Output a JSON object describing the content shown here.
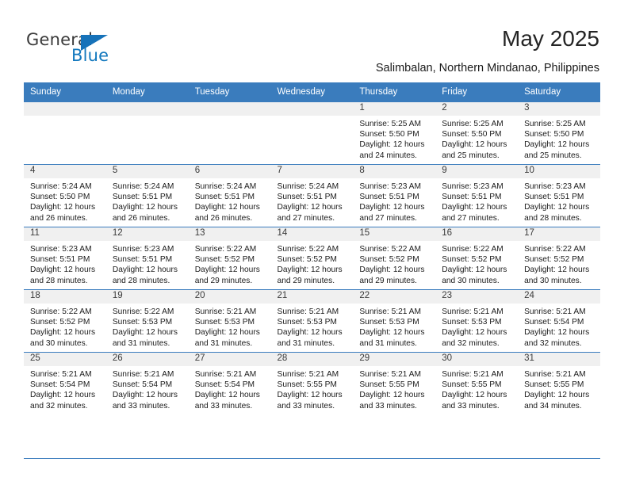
{
  "brand": {
    "name_top": "General",
    "name_bottom": "Blue",
    "triangle_color": "#1672b9",
    "accent_color": "#3a7cbd"
  },
  "header": {
    "title": "May 2025",
    "subtitle": "Salimbalan, Northern Mindanao, Philippines"
  },
  "calendar": {
    "weekday_headers": [
      "Sunday",
      "Monday",
      "Tuesday",
      "Wednesday",
      "Thursday",
      "Friday",
      "Saturday"
    ],
    "weeks": [
      [
        {
          "day": "",
          "lines": []
        },
        {
          "day": "",
          "lines": []
        },
        {
          "day": "",
          "lines": []
        },
        {
          "day": "",
          "lines": []
        },
        {
          "day": "1",
          "lines": [
            "Sunrise: 5:25 AM",
            "Sunset: 5:50 PM",
            "Daylight: 12 hours",
            "and 24 minutes."
          ]
        },
        {
          "day": "2",
          "lines": [
            "Sunrise: 5:25 AM",
            "Sunset: 5:50 PM",
            "Daylight: 12 hours",
            "and 25 minutes."
          ]
        },
        {
          "day": "3",
          "lines": [
            "Sunrise: 5:25 AM",
            "Sunset: 5:50 PM",
            "Daylight: 12 hours",
            "and 25 minutes."
          ]
        }
      ],
      [
        {
          "day": "4",
          "lines": [
            "Sunrise: 5:24 AM",
            "Sunset: 5:50 PM",
            "Daylight: 12 hours",
            "and 26 minutes."
          ]
        },
        {
          "day": "5",
          "lines": [
            "Sunrise: 5:24 AM",
            "Sunset: 5:51 PM",
            "Daylight: 12 hours",
            "and 26 minutes."
          ]
        },
        {
          "day": "6",
          "lines": [
            "Sunrise: 5:24 AM",
            "Sunset: 5:51 PM",
            "Daylight: 12 hours",
            "and 26 minutes."
          ]
        },
        {
          "day": "7",
          "lines": [
            "Sunrise: 5:24 AM",
            "Sunset: 5:51 PM",
            "Daylight: 12 hours",
            "and 27 minutes."
          ]
        },
        {
          "day": "8",
          "lines": [
            "Sunrise: 5:23 AM",
            "Sunset: 5:51 PM",
            "Daylight: 12 hours",
            "and 27 minutes."
          ]
        },
        {
          "day": "9",
          "lines": [
            "Sunrise: 5:23 AM",
            "Sunset: 5:51 PM",
            "Daylight: 12 hours",
            "and 27 minutes."
          ]
        },
        {
          "day": "10",
          "lines": [
            "Sunrise: 5:23 AM",
            "Sunset: 5:51 PM",
            "Daylight: 12 hours",
            "and 28 minutes."
          ]
        }
      ],
      [
        {
          "day": "11",
          "lines": [
            "Sunrise: 5:23 AM",
            "Sunset: 5:51 PM",
            "Daylight: 12 hours",
            "and 28 minutes."
          ]
        },
        {
          "day": "12",
          "lines": [
            "Sunrise: 5:23 AM",
            "Sunset: 5:51 PM",
            "Daylight: 12 hours",
            "and 28 minutes."
          ]
        },
        {
          "day": "13",
          "lines": [
            "Sunrise: 5:22 AM",
            "Sunset: 5:52 PM",
            "Daylight: 12 hours",
            "and 29 minutes."
          ]
        },
        {
          "day": "14",
          "lines": [
            "Sunrise: 5:22 AM",
            "Sunset: 5:52 PM",
            "Daylight: 12 hours",
            "and 29 minutes."
          ]
        },
        {
          "day": "15",
          "lines": [
            "Sunrise: 5:22 AM",
            "Sunset: 5:52 PM",
            "Daylight: 12 hours",
            "and 29 minutes."
          ]
        },
        {
          "day": "16",
          "lines": [
            "Sunrise: 5:22 AM",
            "Sunset: 5:52 PM",
            "Daylight: 12 hours",
            "and 30 minutes."
          ]
        },
        {
          "day": "17",
          "lines": [
            "Sunrise: 5:22 AM",
            "Sunset: 5:52 PM",
            "Daylight: 12 hours",
            "and 30 minutes."
          ]
        }
      ],
      [
        {
          "day": "18",
          "lines": [
            "Sunrise: 5:22 AM",
            "Sunset: 5:52 PM",
            "Daylight: 12 hours",
            "and 30 minutes."
          ]
        },
        {
          "day": "19",
          "lines": [
            "Sunrise: 5:22 AM",
            "Sunset: 5:53 PM",
            "Daylight: 12 hours",
            "and 31 minutes."
          ]
        },
        {
          "day": "20",
          "lines": [
            "Sunrise: 5:21 AM",
            "Sunset: 5:53 PM",
            "Daylight: 12 hours",
            "and 31 minutes."
          ]
        },
        {
          "day": "21",
          "lines": [
            "Sunrise: 5:21 AM",
            "Sunset: 5:53 PM",
            "Daylight: 12 hours",
            "and 31 minutes."
          ]
        },
        {
          "day": "22",
          "lines": [
            "Sunrise: 5:21 AM",
            "Sunset: 5:53 PM",
            "Daylight: 12 hours",
            "and 31 minutes."
          ]
        },
        {
          "day": "23",
          "lines": [
            "Sunrise: 5:21 AM",
            "Sunset: 5:53 PM",
            "Daylight: 12 hours",
            "and 32 minutes."
          ]
        },
        {
          "day": "24",
          "lines": [
            "Sunrise: 5:21 AM",
            "Sunset: 5:54 PM",
            "Daylight: 12 hours",
            "and 32 minutes."
          ]
        }
      ],
      [
        {
          "day": "25",
          "lines": [
            "Sunrise: 5:21 AM",
            "Sunset: 5:54 PM",
            "Daylight: 12 hours",
            "and 32 minutes."
          ]
        },
        {
          "day": "26",
          "lines": [
            "Sunrise: 5:21 AM",
            "Sunset: 5:54 PM",
            "Daylight: 12 hours",
            "and 33 minutes."
          ]
        },
        {
          "day": "27",
          "lines": [
            "Sunrise: 5:21 AM",
            "Sunset: 5:54 PM",
            "Daylight: 12 hours",
            "and 33 minutes."
          ]
        },
        {
          "day": "28",
          "lines": [
            "Sunrise: 5:21 AM",
            "Sunset: 5:55 PM",
            "Daylight: 12 hours",
            "and 33 minutes."
          ]
        },
        {
          "day": "29",
          "lines": [
            "Sunrise: 5:21 AM",
            "Sunset: 5:55 PM",
            "Daylight: 12 hours",
            "and 33 minutes."
          ]
        },
        {
          "day": "30",
          "lines": [
            "Sunrise: 5:21 AM",
            "Sunset: 5:55 PM",
            "Daylight: 12 hours",
            "and 33 minutes."
          ]
        },
        {
          "day": "31",
          "lines": [
            "Sunrise: 5:21 AM",
            "Sunset: 5:55 PM",
            "Daylight: 12 hours",
            "and 34 minutes."
          ]
        }
      ]
    ]
  }
}
